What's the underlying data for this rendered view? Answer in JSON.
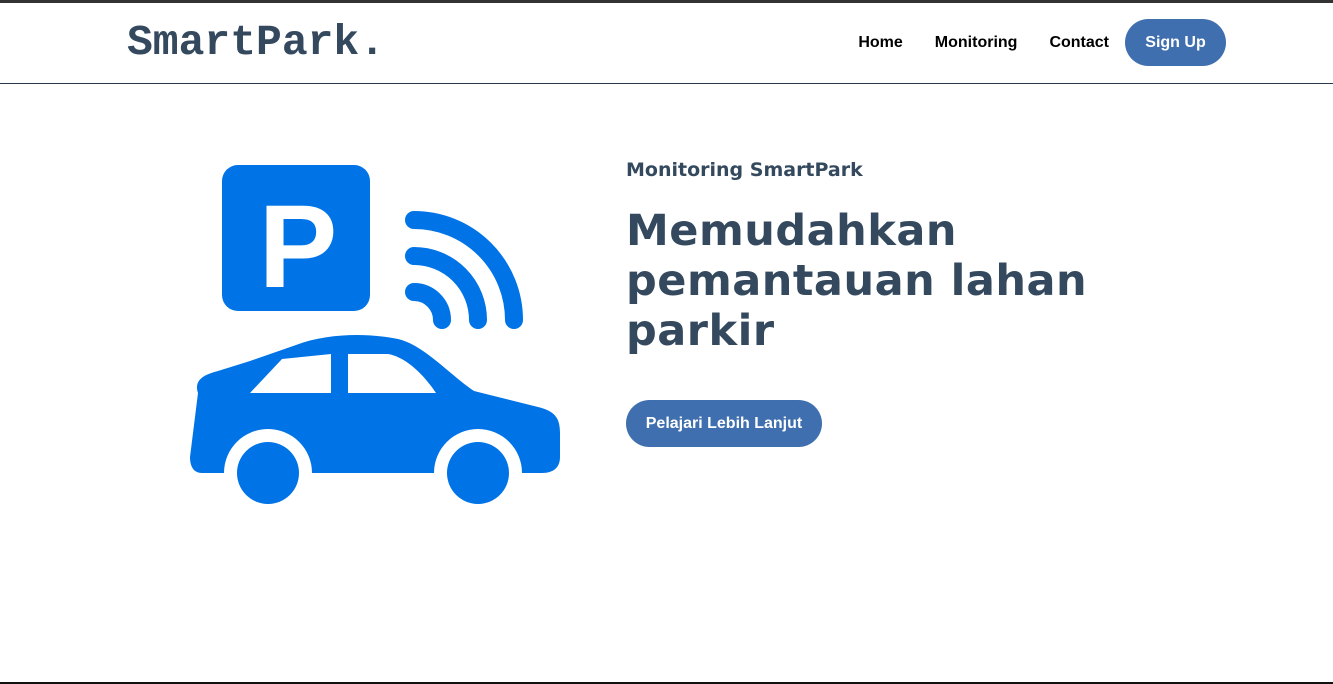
{
  "navbar": {
    "logo": "SmartPark.",
    "links": [
      "Home",
      "Monitoring",
      "Contact"
    ],
    "signup_label": "Sign Up"
  },
  "hero": {
    "subtitle": "Monitoring SmartPark",
    "headline": "Memudahkan pemantauan lahan parkir",
    "cta_label": "Pelajari Lebih Lanjut",
    "illustration": {
      "icon": "smart-parking-car-icon",
      "color": "#0073e6",
      "letter": "P"
    }
  },
  "colors": {
    "brand_text": "#34495e",
    "button": "#3f6fae",
    "icon": "#0073e6"
  }
}
